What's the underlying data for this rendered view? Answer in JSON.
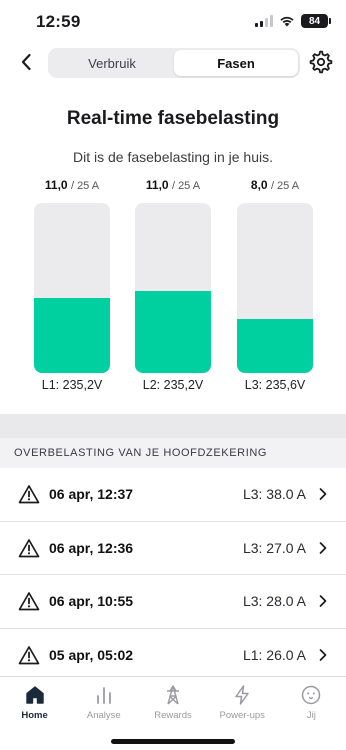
{
  "status_bar": {
    "time": "12:59",
    "battery": "84"
  },
  "nav": {
    "segments": [
      {
        "label": "Verbruik",
        "active": false
      },
      {
        "label": "Fasen",
        "active": true
      }
    ]
  },
  "title": "Real-time fasebelasting",
  "subtitle": "Dit is de fasebelasting in je huis.",
  "phases": [
    {
      "current": "11,0",
      "max": "/ 25 A",
      "voltage": "L1: 235,2V",
      "load_fraction": 0.44
    },
    {
      "current": "11,0",
      "max": "/ 25 A",
      "voltage": "L2: 235,2V",
      "load_fraction": 0.48
    },
    {
      "current": "8,0",
      "max": "/ 25 A",
      "voltage": "L3: 235,6V",
      "load_fraction": 0.32
    }
  ],
  "accent_color": "#00cfa0",
  "overload": {
    "header": "OVERBELASTING VAN JE HOOFDZEKERING",
    "events": [
      {
        "date": "06 apr, 12:37",
        "value": "L3: 38.0 A"
      },
      {
        "date": "06 apr, 12:36",
        "value": "L3: 27.0 A"
      },
      {
        "date": "06 apr, 10:55",
        "value": "L3: 28.0 A"
      },
      {
        "date": "05 apr, 05:02",
        "value": "L1: 26.0 A"
      }
    ]
  },
  "tabs": [
    {
      "label": "Home",
      "icon": "home-icon",
      "active": true
    },
    {
      "label": "Analyse",
      "icon": "analyse-icon",
      "active": false
    },
    {
      "label": "Rewards",
      "icon": "pylon-icon",
      "active": false
    },
    {
      "label": "Power-ups",
      "icon": "bolt-icon",
      "active": false
    },
    {
      "label": "Jij",
      "icon": "face-icon",
      "active": false
    }
  ]
}
